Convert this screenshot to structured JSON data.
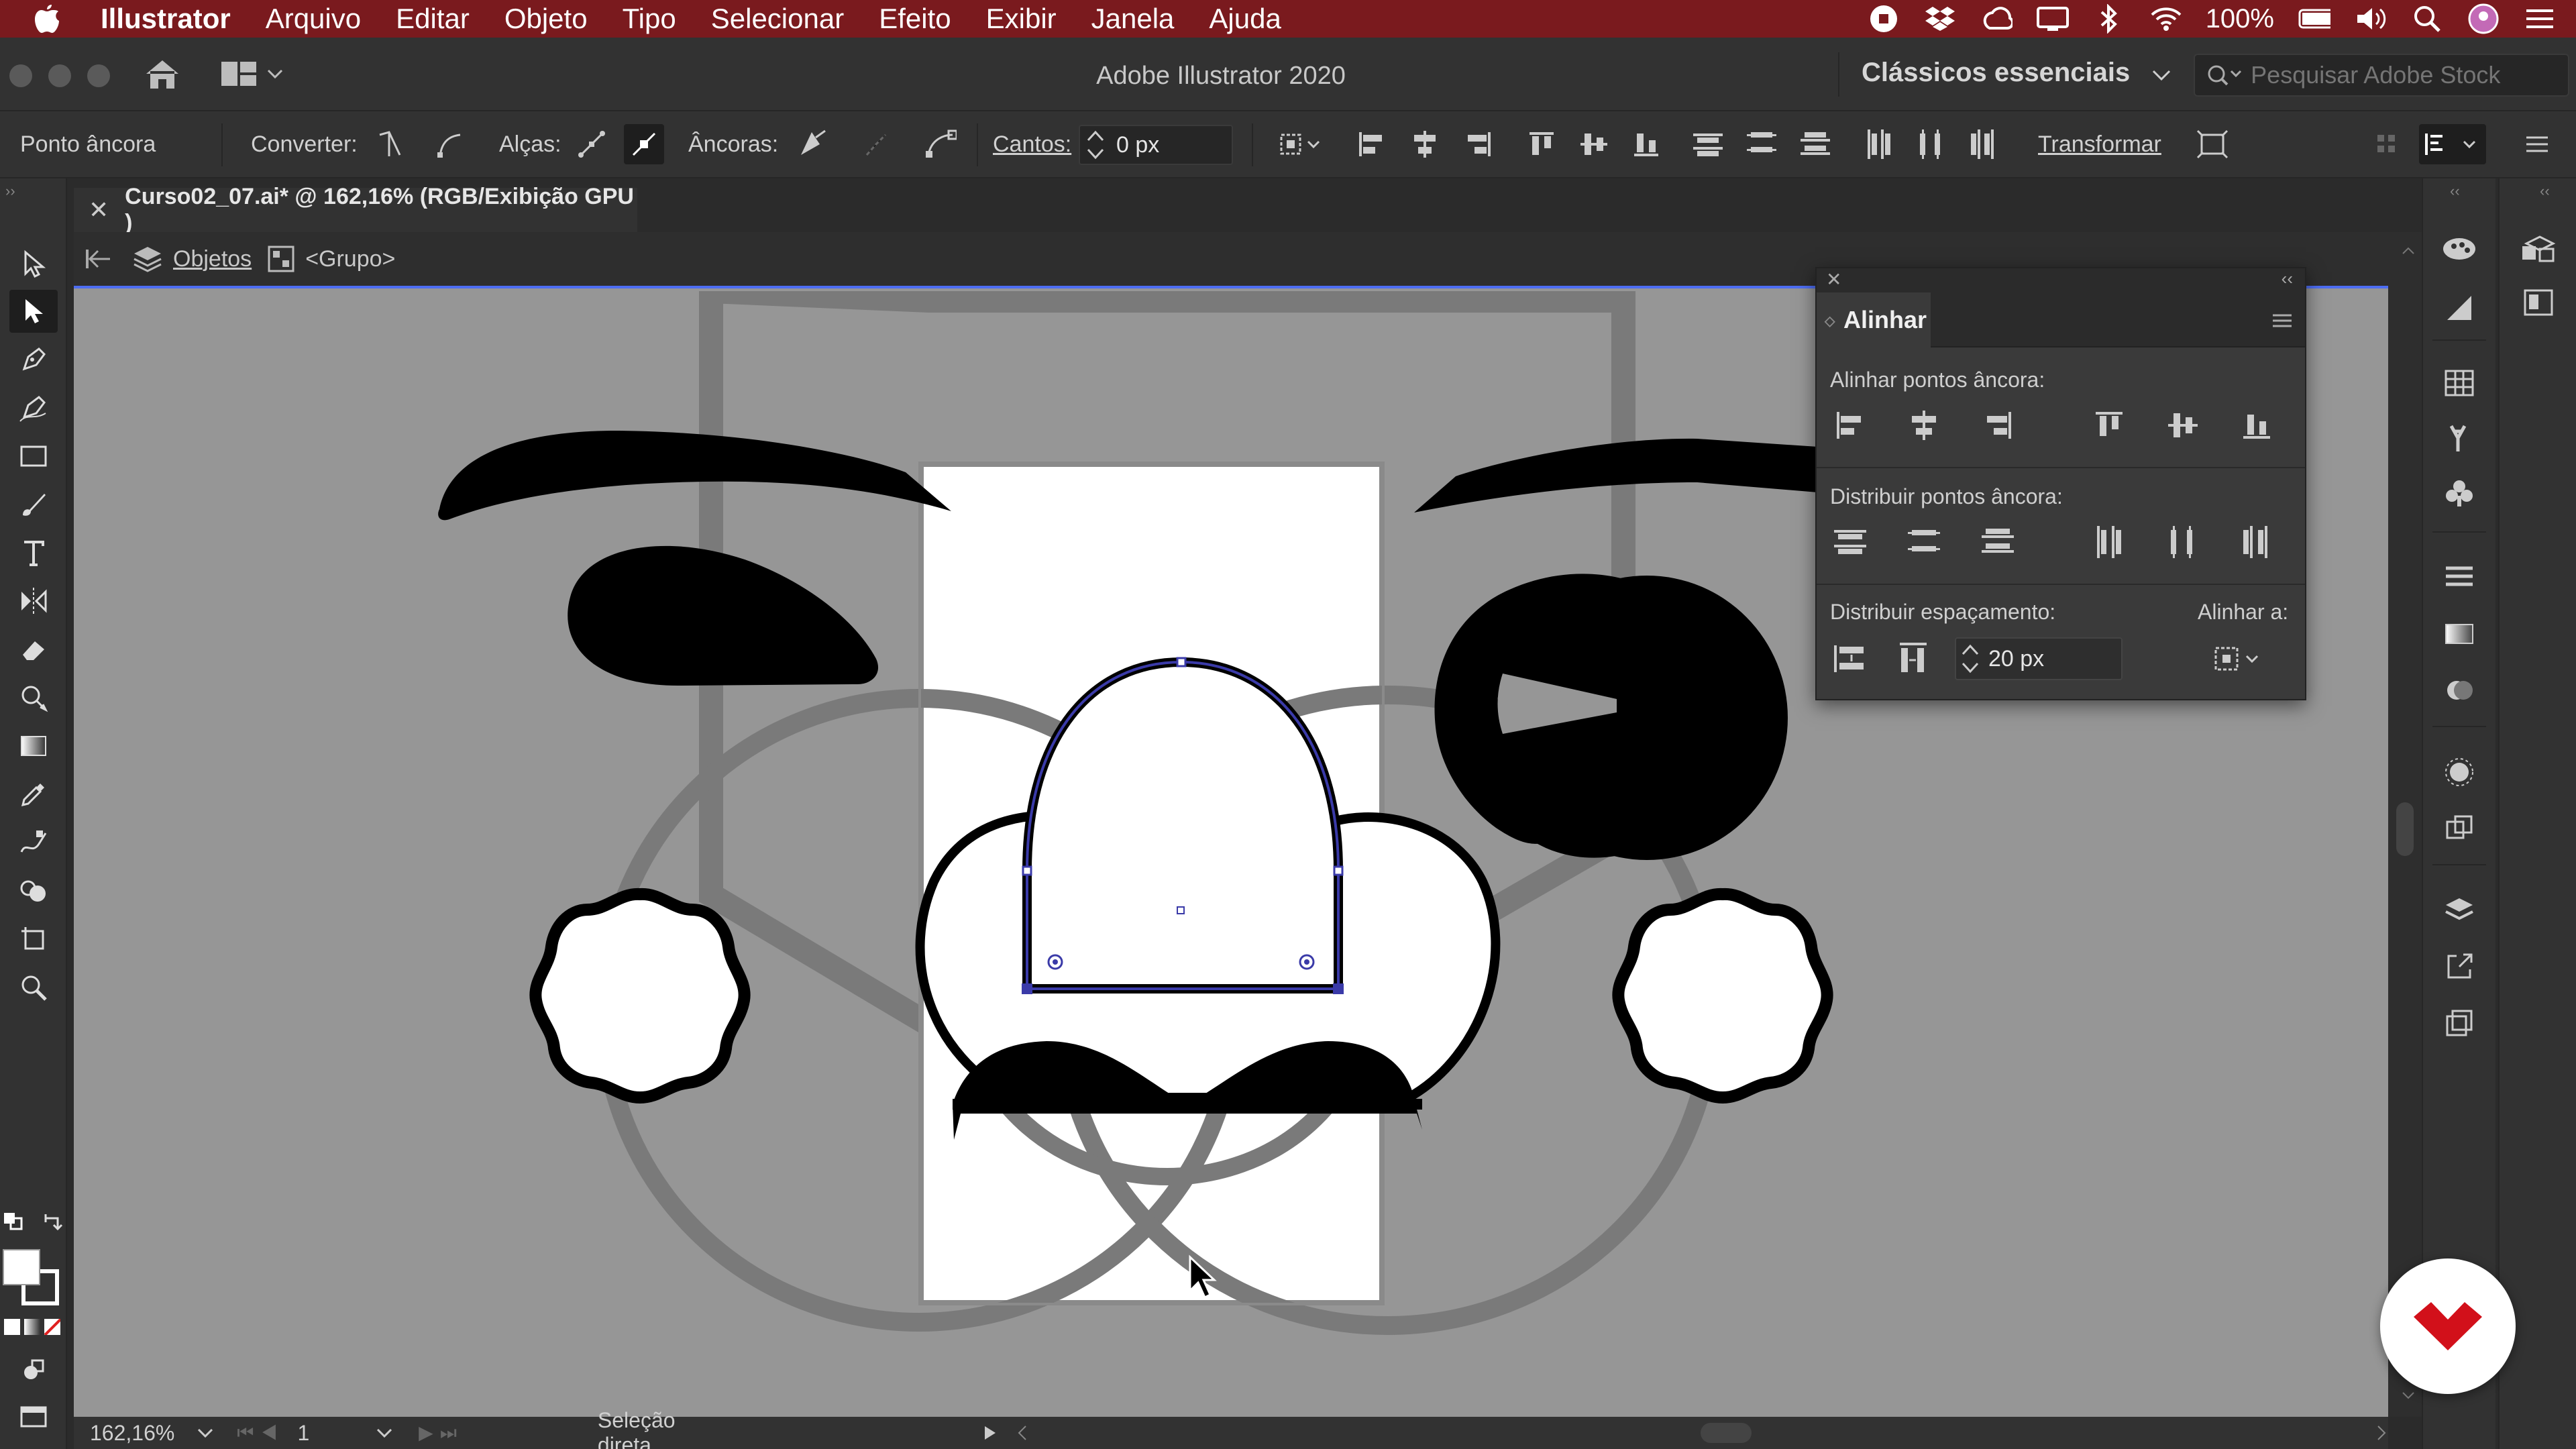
{
  "menubar": {
    "app_name": "Illustrator",
    "items": [
      "Arquivo",
      "Editar",
      "Objeto",
      "Tipo",
      "Selecionar",
      "Efeito",
      "Exibir",
      "Janela",
      "Ajuda"
    ],
    "battery": "100%"
  },
  "titlebar": {
    "title": "Adobe Illustrator 2020",
    "workspace": "Clássicos essenciais",
    "search_placeholder": "Pesquisar Adobe Stock"
  },
  "controlbar": {
    "selection_type": "Ponto âncora",
    "convert_label": "Converter:",
    "handles_label": "Alças:",
    "anchors_label": "Âncoras:",
    "corners_label": "Cantos:",
    "corners_value": "0 px",
    "transform_label": "Transformar"
  },
  "document": {
    "tab_title": "Curso02_07.ai* @ 162,16% (RGB/Exibição GPU )",
    "breadcrumb_layer": "Objetos",
    "breadcrumb_group": "<Grupo>"
  },
  "statusbar": {
    "zoom": "162,16%",
    "artboard": "1",
    "tool": "Seleção direta"
  },
  "align_panel": {
    "title": "Alinhar",
    "section_align": "Alinhar pontos âncora:",
    "section_distribute": "Distribuir pontos âncora:",
    "section_spacing": "Distribuir espaçamento:",
    "align_to_label": "Alinhar a:",
    "spacing_value": "20 px"
  },
  "colors": {
    "menubar_bg": "#7a1a1e",
    "canvas_bg": "#969696",
    "selection_blue": "#2b2f8f",
    "badge_red": "#d2101a"
  }
}
